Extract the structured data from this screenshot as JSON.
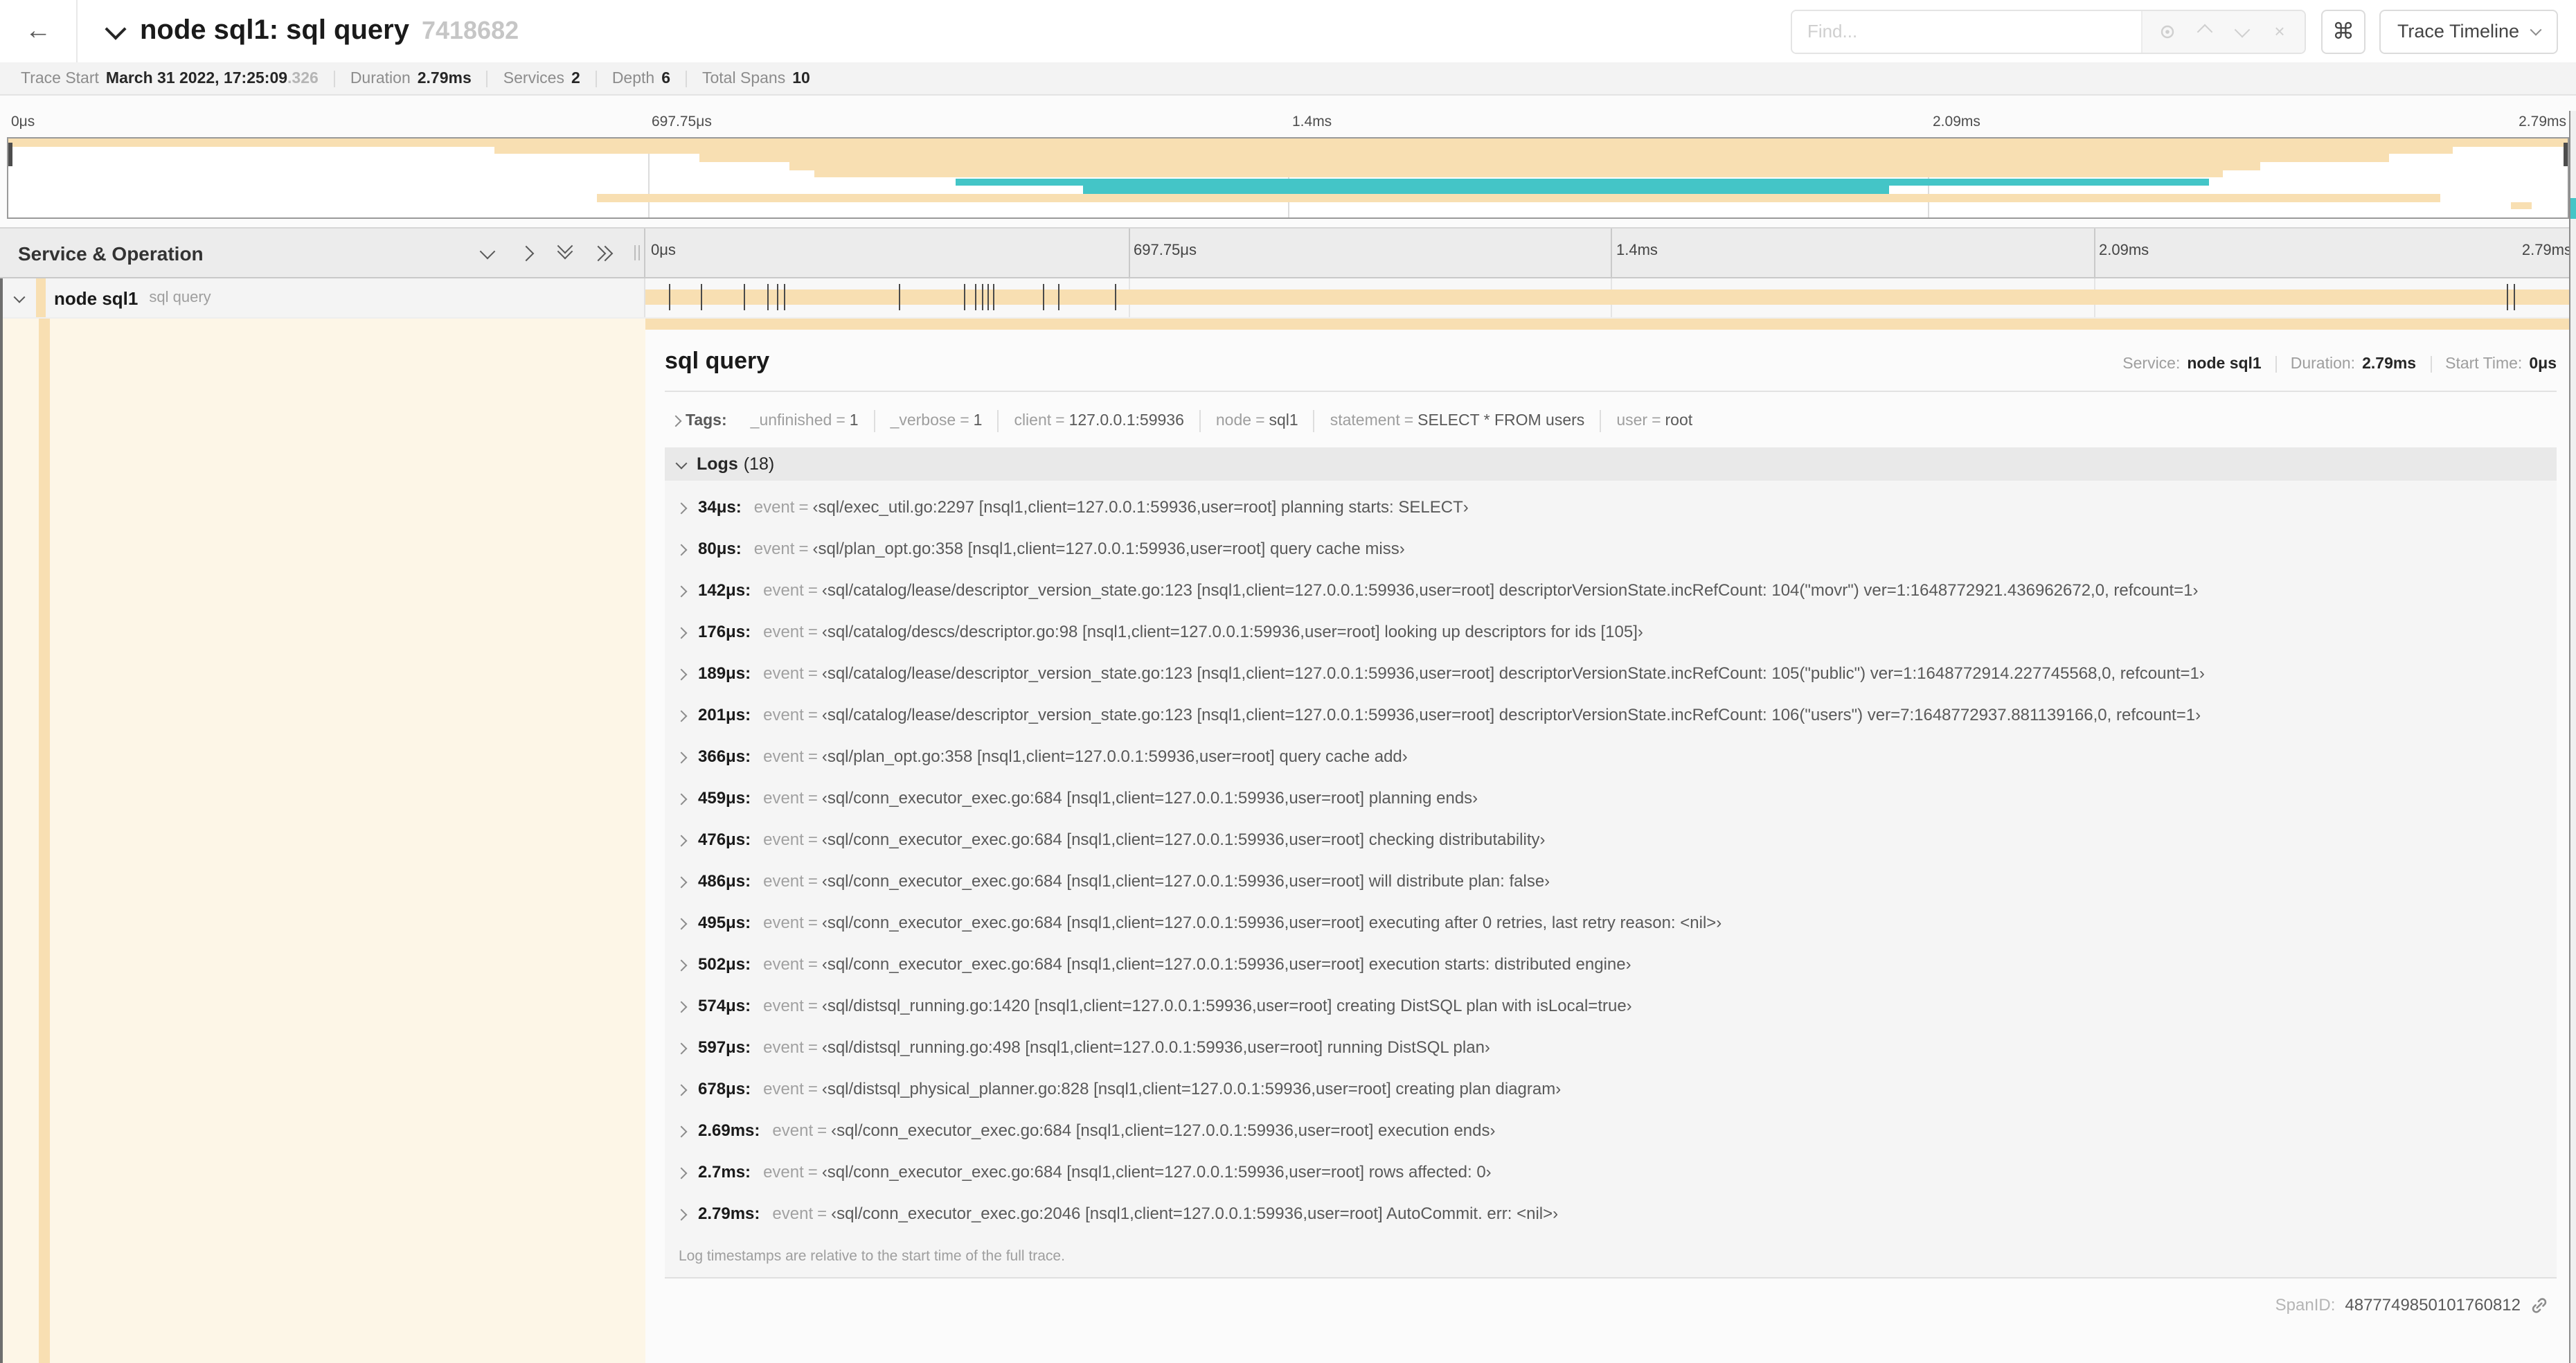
{
  "colors": {
    "tan": "#F8DFB2",
    "teal": "#44C5C7",
    "tick": "#4a4a4a"
  },
  "window": {
    "back_icon": "←",
    "title": "node sql1: sql query",
    "trace_id": "7418682",
    "find_placeholder": "Find...",
    "clear_icon": "×",
    "shortcut_key": "⌘",
    "view_selector": "Trace Timeline"
  },
  "trace_meta": [
    {
      "label": "Trace Start",
      "value": "March 31 2022, 17:25:09",
      "suffix": ".326"
    },
    {
      "label": "Duration",
      "value": "2.79ms"
    },
    {
      "label": "Services",
      "value": "2"
    },
    {
      "label": "Depth",
      "value": "6"
    },
    {
      "label": "Total Spans",
      "value": "10"
    }
  ],
  "minimap": {
    "ticks": [
      "0μs",
      "697.75μs",
      "1.4ms",
      "2.09ms",
      "2.79ms"
    ],
    "spans": [
      {
        "start": 0,
        "end": 100,
        "color": "tan"
      },
      {
        "start": 19,
        "end": 95.5,
        "color": "tan"
      },
      {
        "start": 27,
        "end": 93,
        "color": "tan"
      },
      {
        "start": 30.5,
        "end": 88,
        "color": "tan"
      },
      {
        "start": 31.5,
        "end": 86.5,
        "color": "tan"
      },
      {
        "start": 37,
        "end": 86,
        "color": "teal"
      },
      {
        "start": 42,
        "end": 73.5,
        "color": "teal"
      },
      {
        "start": 23,
        "end": 95,
        "color": "tan"
      },
      {
        "start": 97.8,
        "end": 98.6,
        "color": "tan"
      }
    ]
  },
  "timeline": {
    "left_header": "Service & Operation",
    "ticks": [
      "0μs",
      "697.75μs",
      "1.4ms",
      "2.09ms",
      "2.79ms"
    ]
  },
  "span_row": {
    "service": "node sql1",
    "operation": "sql query",
    "log_marker_percents": [
      1.2,
      2.9,
      5.1,
      6.3,
      6.8,
      7.2,
      13.1,
      16.5,
      17.1,
      17.4,
      17.7,
      18.0,
      20.6,
      21.4,
      24.3,
      96.4,
      96.8,
      99.8
    ]
  },
  "detail": {
    "title": "sql query",
    "meta": [
      {
        "label": "Service:",
        "value": "node sql1"
      },
      {
        "label": "Duration:",
        "value": "2.79ms"
      },
      {
        "label": "Start Time:",
        "value": "0μs"
      }
    ],
    "tags_label": "Tags:",
    "tags": [
      {
        "key": "_unfinished",
        "value": "1"
      },
      {
        "key": "_verbose",
        "value": "1"
      },
      {
        "key": "client",
        "value": "127.0.0.1:59936"
      },
      {
        "key": "node",
        "value": "sql1"
      },
      {
        "key": "statement",
        "value": "SELECT * FROM users"
      },
      {
        "key": "user",
        "value": "root"
      }
    ],
    "logs_label": "Logs",
    "logs_count": "(18)",
    "logs": [
      {
        "time": "34μs:",
        "key": "event",
        "value": "‹sql/exec_util.go:2297 [nsql1,client=127.0.0.1:59936,user=root] planning starts: SELECT›"
      },
      {
        "time": "80μs:",
        "key": "event",
        "value": "‹sql/plan_opt.go:358 [nsql1,client=127.0.0.1:59936,user=root] query cache miss›"
      },
      {
        "time": "142μs:",
        "key": "event",
        "value": "‹sql/catalog/lease/descriptor_version_state.go:123 [nsql1,client=127.0.0.1:59936,user=root] descriptorVersionState.incRefCount: 104(\"movr\") ver=1:1648772921.436962672,0, refcount=1›"
      },
      {
        "time": "176μs:",
        "key": "event",
        "value": "‹sql/catalog/descs/descriptor.go:98 [nsql1,client=127.0.0.1:59936,user=root] looking up descriptors for ids [105]›"
      },
      {
        "time": "189μs:",
        "key": "event",
        "value": "‹sql/catalog/lease/descriptor_version_state.go:123 [nsql1,client=127.0.0.1:59936,user=root] descriptorVersionState.incRefCount: 105(\"public\") ver=1:1648772914.227745568,0, refcount=1›"
      },
      {
        "time": "201μs:",
        "key": "event",
        "value": "‹sql/catalog/lease/descriptor_version_state.go:123 [nsql1,client=127.0.0.1:59936,user=root] descriptorVersionState.incRefCount: 106(\"users\") ver=7:1648772937.881139166,0, refcount=1›"
      },
      {
        "time": "366μs:",
        "key": "event",
        "value": "‹sql/plan_opt.go:358 [nsql1,client=127.0.0.1:59936,user=root] query cache add›"
      },
      {
        "time": "459μs:",
        "key": "event",
        "value": "‹sql/conn_executor_exec.go:684 [nsql1,client=127.0.0.1:59936,user=root] planning ends›"
      },
      {
        "time": "476μs:",
        "key": "event",
        "value": "‹sql/conn_executor_exec.go:684 [nsql1,client=127.0.0.1:59936,user=root] checking distributability›"
      },
      {
        "time": "486μs:",
        "key": "event",
        "value": "‹sql/conn_executor_exec.go:684 [nsql1,client=127.0.0.1:59936,user=root] will distribute plan: false›"
      },
      {
        "time": "495μs:",
        "key": "event",
        "value": "‹sql/conn_executor_exec.go:684 [nsql1,client=127.0.0.1:59936,user=root] executing after 0 retries, last retry reason: <nil>›"
      },
      {
        "time": "502μs:",
        "key": "event",
        "value": "‹sql/conn_executor_exec.go:684 [nsql1,client=127.0.0.1:59936,user=root] execution starts: distributed engine›"
      },
      {
        "time": "574μs:",
        "key": "event",
        "value": "‹sql/distsql_running.go:1420 [nsql1,client=127.0.0.1:59936,user=root] creating DistSQL plan with isLocal=true›"
      },
      {
        "time": "597μs:",
        "key": "event",
        "value": "‹sql/distsql_running.go:498 [nsql1,client=127.0.0.1:59936,user=root] running DistSQL plan›"
      },
      {
        "time": "678μs:",
        "key": "event",
        "value": "‹sql/distsql_physical_planner.go:828 [nsql1,client=127.0.0.1:59936,user=root] creating plan diagram›"
      },
      {
        "time": "2.69ms:",
        "key": "event",
        "value": "‹sql/conn_executor_exec.go:684 [nsql1,client=127.0.0.1:59936,user=root] execution ends›"
      },
      {
        "time": "2.7ms:",
        "key": "event",
        "value": "‹sql/conn_executor_exec.go:684 [nsql1,client=127.0.0.1:59936,user=root] rows affected: 0›"
      },
      {
        "time": "2.79ms:",
        "key": "event",
        "value": "‹sql/conn_executor_exec.go:2046 [nsql1,client=127.0.0.1:59936,user=root] AutoCommit. err: <nil>›"
      }
    ],
    "logs_footnote": "Log timestamps are relative to the start time of the full trace.",
    "spanid_label": "SpanID:",
    "spanid_value": "4877749850101760812"
  }
}
